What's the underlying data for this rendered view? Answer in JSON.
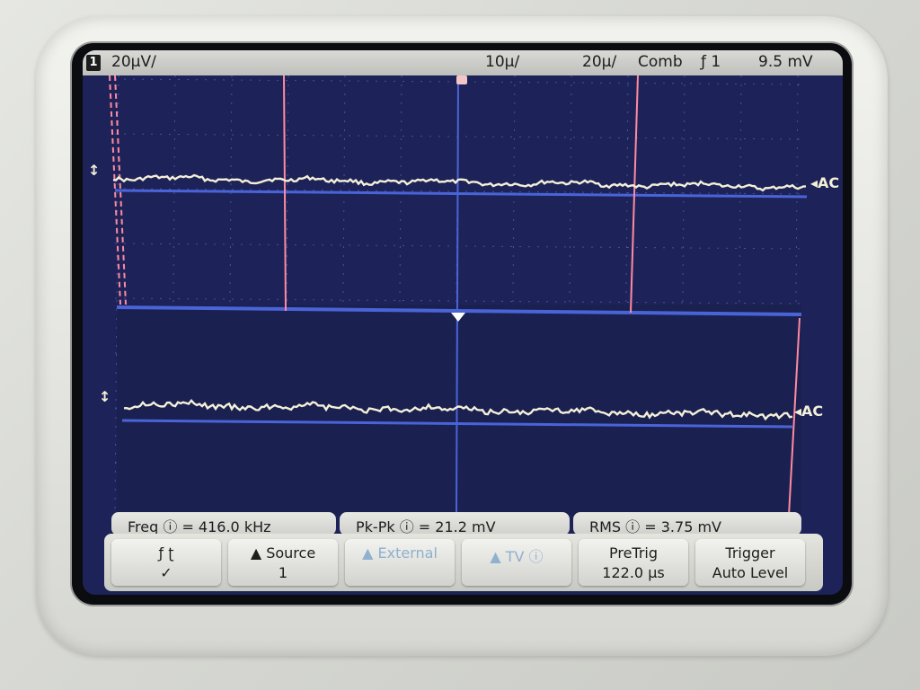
{
  "topbar": {
    "channel": "1",
    "ch_scale": "20µV/",
    "timebase": "10µ/",
    "time_scale": "20µ/",
    "trigger_mode": "Comb",
    "trigger_edge_channel": "ƒ 1",
    "trigger_level": "9.5 mV"
  },
  "measurements": {
    "freq": "Freq ⓘ = 416.0 kHz",
    "pkpk": "Pk-Pk ⓘ = 21.2 mV",
    "rms": "RMS ⓘ = 3.75 mV"
  },
  "softkeys": {
    "slope": {
      "line1": "ƒ    ʈ",
      "line2": "✓"
    },
    "source": {
      "line1": "▲ Source",
      "line2": "1"
    },
    "external": {
      "line1": "▲ External",
      "line2": ""
    },
    "tv": {
      "line1": "▲ TV ⓘ",
      "line2": ""
    },
    "pretrig": {
      "line1": "PreTrig",
      "line2": "122.0 µs"
    },
    "trigger": {
      "line1": "Trigger",
      "line2": "Auto Level"
    }
  },
  "markers": {
    "left_upper": "↕",
    "right_upper": "◂AC",
    "left_lower": "↕",
    "right_lower": "◂AC"
  },
  "colors": {
    "screen": "#1d2358",
    "trace": "#f4f0d8",
    "cursor": "#ff8aa0",
    "baseline": "#4a64d8"
  }
}
